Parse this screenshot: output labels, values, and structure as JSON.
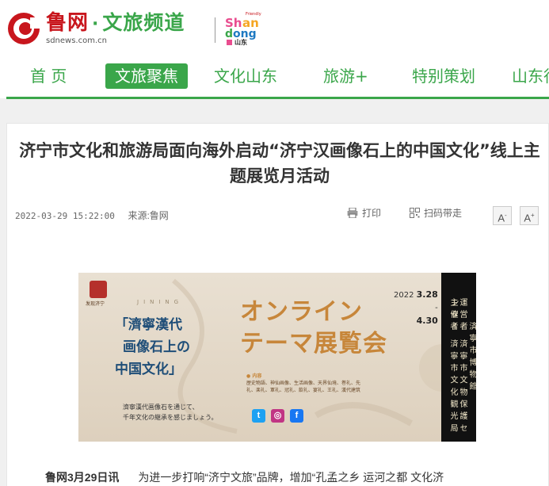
{
  "site": {
    "logo_name": "鲁网",
    "logo_dot": "·",
    "channel": "文旅频道",
    "url": "sdnews.com.cn",
    "partner_logo": "Friendly Shandong 山东"
  },
  "nav": {
    "items": [
      {
        "label": "首 页"
      },
      {
        "label": "文旅聚焦"
      },
      {
        "label": "文化山东"
      },
      {
        "label": "旅游+"
      },
      {
        "label": "特别策划"
      },
      {
        "label": "山东行"
      }
    ]
  },
  "article": {
    "title": "济宁市文化和旅游局面向海外启动“济宁汉画像石上的中国文化”线上主题展览月活动",
    "date": "2022-03-29 15:22:00",
    "source": "来源:鲁网",
    "print_label": "打印",
    "qr_label": "扫码带走",
    "font_small": "A",
    "font_large": "A",
    "lead": "鲁网3月29日讯",
    "body_first_line": "为进一步打响“济宁文旅”品牌，增加“孔孟之乡 运河之都 文化济"
  },
  "banner": {
    "seal_text": "发现济宁",
    "jining": "JINING",
    "title_lines": [
      "「濟寧漢代",
      "画像石上の",
      "中国文化」"
    ],
    "big_line1": "オンライン",
    "big_line2": "テーマ展覧会",
    "date_year": "2022",
    "date_start": "3.28",
    "date_sep": "-",
    "date_end": "4.30",
    "small_line1": "濟寧漢代画像石を通じて、",
    "small_line2": "千年文化の継承を感じましょう。",
    "content_label": "● 内容",
    "content_line1": "歴史物語、神仙画像、生活画像、天界仙境、巻礼、先",
    "content_line2": "礼、楽礼、軍礼、冠礼、飲礼、宴礼、王礼、漢代建筑",
    "organizer": "主 催 者　済 寧 市 文 化 観 光 局",
    "operator": "運 営 者　済 寧 市 文 物 保 護 セ ン タ ー",
    "museum": "済 寧 市 博 物 館"
  }
}
